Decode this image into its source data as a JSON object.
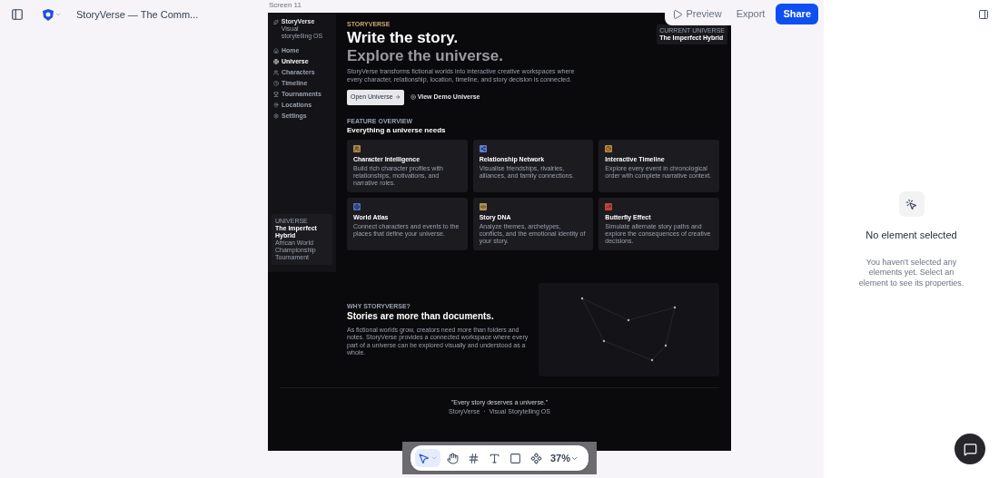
{
  "top_bar": {
    "title": "StoryVerse — The Comm..."
  },
  "actions": [
    {
      "label": "Preview",
      "kind": "preview"
    },
    {
      "label": "Export",
      "kind": "plain"
    },
    {
      "label": "Share",
      "kind": "primary"
    }
  ],
  "canvas": {
    "frame_label": "Screen 11",
    "page": {
      "brand": {
        "name": "StoryVerse",
        "tagline": "Visual storytelling OS"
      },
      "nav": [
        {
          "label": "Home",
          "selected": false
        },
        {
          "label": "Universe",
          "selected": true
        },
        {
          "label": "Characters",
          "selected": false
        },
        {
          "label": "Timeline",
          "selected": false
        },
        {
          "label": "Tournaments",
          "selected": false
        },
        {
          "label": "Locations",
          "selected": false
        },
        {
          "label": "Settings",
          "selected": false
        }
      ],
      "sidebar_card": {
        "label": "UNIVERSE",
        "title": "The Imperfect Hybrid",
        "subtitle": "African World Championship Tournament"
      },
      "current_universe": {
        "label": "CURRENT UNIVERSE",
        "title": "The Imperfect Hybrid"
      },
      "hero": {
        "eyebrow": "STORYVERSE",
        "title": "Write the story.",
        "subtitle": "Explore the universe.",
        "body": "StoryVerse transforms fictional worlds into interactive creative workspaces where every character, relationship, location, timeline, and story decision is connected.",
        "primary": "Open Universe",
        "secondary": "View Demo Universe"
      },
      "features": {
        "eyebrow": "FEATURE OVERVIEW",
        "title": "Everything a universe needs",
        "items": [
          {
            "title": "Character Intelligence",
            "body": "Build rich character profiles with relationships, motivations, and narrative roles.",
            "color": "#b08a4a",
            "kind": "person"
          },
          {
            "title": "Relationship Network",
            "body": "Visualise friendships, rivalries, alliances, and family connections.",
            "color": "#5b7fd6",
            "kind": "network"
          },
          {
            "title": "Interactive Timeline",
            "body": "Explore every event in chronological order with complete narrative context.",
            "color": "#c08a3e",
            "kind": "clock"
          },
          {
            "title": "World Atlas",
            "body": "Connect characters and events to the places that define your universe.",
            "color": "#4a6fc4",
            "kind": "globe"
          },
          {
            "title": "Story DNA",
            "body": "Analyze themes, archetypes, conflicts, and the emotional identity of your story.",
            "color": "#b39550",
            "kind": "dna"
          },
          {
            "title": "Butterfly Effect",
            "body": "Simulate alternate story paths and explore the consequences of creative decisions.",
            "color": "#c0443c",
            "kind": "trend"
          }
        ]
      },
      "why": {
        "eyebrow": "WHY STORYVERSE?",
        "title": "Stories are more than documents.",
        "body": "As fictional worlds grow, creators need more than folders and notes. StoryVerse provides a connected workspace where every part of a universe can be explored visually and understood as a whole."
      },
      "footer": {
        "quote": "\"Every story deserves a universe.\"",
        "caption": "StoryVerse  ·  Visual Storytelling OS"
      }
    }
  },
  "toolbar": {
    "tools": [
      {
        "kind": "pointer",
        "selected": true
      },
      {
        "kind": "hand",
        "selected": false
      },
      {
        "kind": "frame",
        "selected": false
      },
      {
        "kind": "text",
        "selected": false
      },
      {
        "kind": "rect",
        "selected": false
      },
      {
        "kind": "component",
        "selected": false
      }
    ],
    "zoom": "37%"
  },
  "inspector": {
    "title": "No element selected",
    "body": "You haven't selected any elements yet. Select an element to see its properties."
  }
}
